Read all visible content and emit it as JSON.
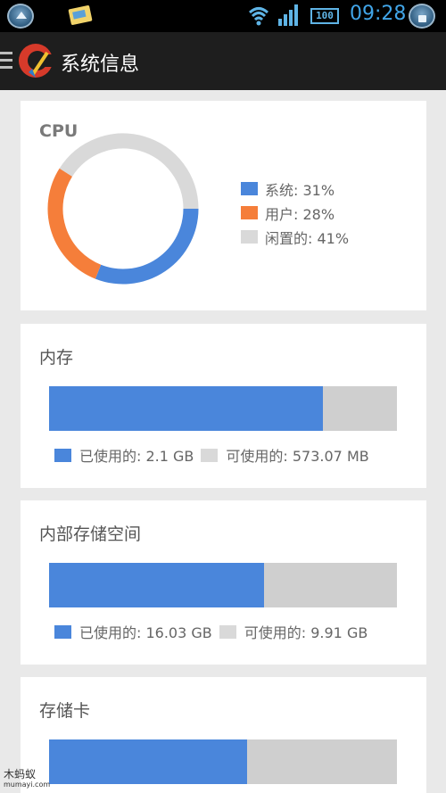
{
  "status_bar": {
    "time": "09:28",
    "battery": "100",
    "icons": [
      "home-icon",
      "notes-icon",
      "wifi-icon",
      "signal-icon",
      "battery-icon",
      "lock-icon"
    ]
  },
  "app_bar": {
    "title": "系统信息",
    "icons": [
      "menu-icon",
      "ccleaner-logo-icon"
    ]
  },
  "colors": {
    "accent_blue": "#4a86db",
    "accent_orange": "#f57e3a",
    "idle_gray": "#d9d9d9",
    "bar_free_gray": "#cfcfcf"
  },
  "cpu_card": {
    "title": "CPU",
    "legend": [
      {
        "label": "系统: 31%",
        "color": "#4a86db"
      },
      {
        "label": "用户: 28%",
        "color": "#f57e3a"
      },
      {
        "label": "闲置的: 41%",
        "color": "#d9d9d9"
      }
    ]
  },
  "memory_card": {
    "title": "内存",
    "used_label": "已使用的: 2.1 GB",
    "free_label": "可使用的: 573.07 MB",
    "used_fraction": 0.786
  },
  "internal_storage_card": {
    "title": "内部存储空间",
    "used_label": "已使用的: 16.03 GB",
    "free_label": "可使用的: 9.91 GB",
    "used_fraction": 0.618
  },
  "sd_card": {
    "title": "存储卡",
    "used_fraction": 0.568
  },
  "watermark": {
    "line1": "木蚂蚁",
    "line2": "mumayi.com"
  },
  "chart_data": {
    "type": "pie",
    "categories": [
      "系统",
      "用户",
      "闲置的"
    ],
    "values": [
      31,
      28,
      41
    ],
    "colors": [
      "#4a86db",
      "#f57e3a",
      "#d9d9d9"
    ],
    "title": "CPU",
    "legend_position": "right"
  }
}
